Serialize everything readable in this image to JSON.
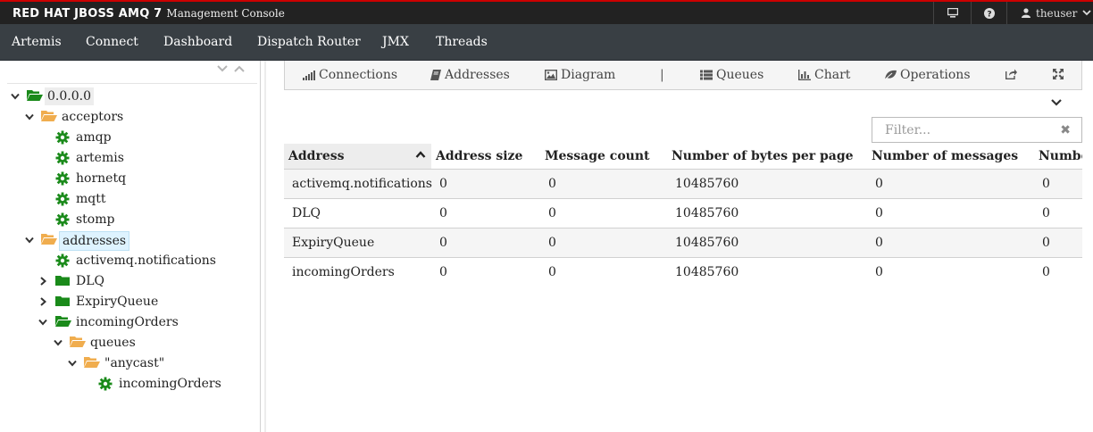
{
  "masthead": {
    "brand": "RED HAT JBOSS AMQ 7",
    "subtitle": "Management Console",
    "user": "theuser",
    "accent_color": "#cc0000"
  },
  "nav": {
    "items": [
      "Artemis",
      "Connect",
      "Dashboard",
      "Dispatch Router",
      "JMX",
      "Threads"
    ]
  },
  "tree": {
    "nodes": [
      {
        "label": "0.0.0.0",
        "icon": "folder-open-icon"
      },
      {
        "label": "acceptors",
        "icon": "folder-open-outline-icon"
      },
      {
        "label": "amqp",
        "icon": "gear-icon"
      },
      {
        "label": "artemis",
        "icon": "gear-icon"
      },
      {
        "label": "hornetq",
        "icon": "gear-icon"
      },
      {
        "label": "mqtt",
        "icon": "gear-icon"
      },
      {
        "label": "stomp",
        "icon": "gear-icon"
      },
      {
        "label": "addresses",
        "icon": "folder-open-outline-icon"
      },
      {
        "label": "activemq.notifications",
        "icon": "gear-icon"
      },
      {
        "label": "DLQ",
        "icon": "folder-icon"
      },
      {
        "label": "ExpiryQueue",
        "icon": "folder-icon"
      },
      {
        "label": "incomingOrders",
        "icon": "folder-open-icon"
      },
      {
        "label": "queues",
        "icon": "folder-open-outline-icon"
      },
      {
        "label": "\"anycast\"",
        "icon": "folder-open-outline-icon"
      },
      {
        "label": "incomingOrders",
        "icon": "gear-icon"
      }
    ]
  },
  "tabs": {
    "items": [
      {
        "label": "Connections",
        "icon": "signal-icon"
      },
      {
        "label": "Addresses",
        "icon": "book-icon"
      },
      {
        "label": "Diagram",
        "icon": "picture-icon"
      },
      {
        "label": "Queues",
        "icon": "list-icon"
      },
      {
        "label": "Chart",
        "icon": "bar-chart-icon"
      },
      {
        "label": "Operations",
        "icon": "leaf-icon"
      }
    ],
    "separator": "|"
  },
  "filter": {
    "placeholder": "Filter..."
  },
  "table": {
    "columns": [
      "Address",
      "Address size",
      "Message count",
      "Number of bytes per page",
      "Number of messages",
      "Number"
    ],
    "rows": [
      [
        "activemq.notifications",
        "0",
        "0",
        "10485760",
        "0",
        "0"
      ],
      [
        "DLQ",
        "0",
        "0",
        "10485760",
        "0",
        "0"
      ],
      [
        "ExpiryQueue",
        "0",
        "0",
        "10485760",
        "0",
        "0"
      ],
      [
        "incomingOrders",
        "0",
        "0",
        "10485760",
        "0",
        "0"
      ]
    ]
  }
}
